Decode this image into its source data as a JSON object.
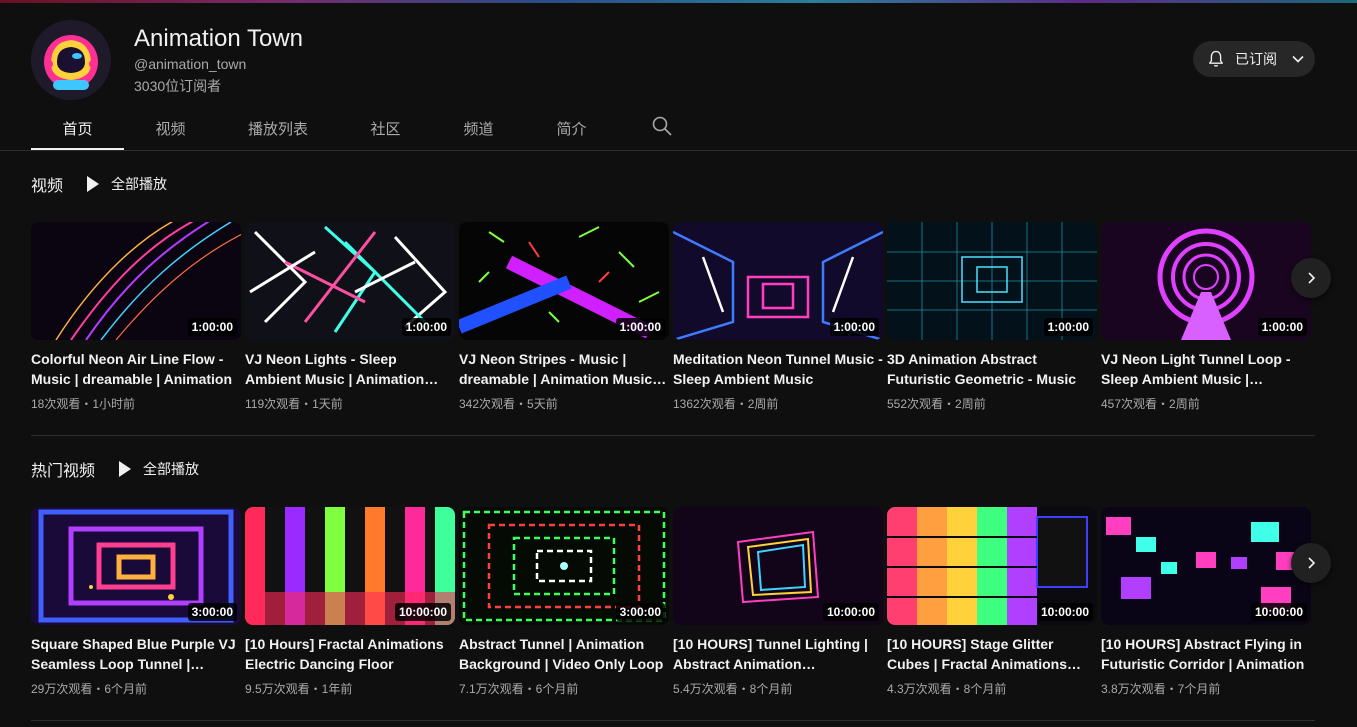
{
  "channel": {
    "name": "Animation Town",
    "handle": "@animation_town",
    "subscribers": "3030位订阅者",
    "subscribe_label": "已订阅"
  },
  "tabs": [
    {
      "label": "首页",
      "active": true
    },
    {
      "label": "视频",
      "active": false
    },
    {
      "label": "播放列表",
      "active": false
    },
    {
      "label": "社区",
      "active": false
    },
    {
      "label": "频道",
      "active": false
    },
    {
      "label": "简介",
      "active": false
    }
  ],
  "icons": {
    "search": "search-icon",
    "bell": "bell-icon",
    "chevron": "chevron-down-icon",
    "next": "chevron-right-icon",
    "play": "play-icon"
  },
  "shelves": [
    {
      "title": "视频",
      "play_all": "全部播放",
      "videos": [
        {
          "title": "Colorful Neon Air Line Flow - Music | dreamable | Animation",
          "duration": "1:00:00",
          "meta": "18次观看・1小时前",
          "theme": "lines"
        },
        {
          "title": "VJ Neon Lights - Sleep Ambient Music | Animation Background",
          "duration": "1:00:00",
          "meta": "119次观看・1天前",
          "theme": "shards"
        },
        {
          "title": "VJ Neon Stripes - Music | dreamable | Animation Music Video",
          "duration": "1:00:00",
          "meta": "342次观看・5天前",
          "theme": "stripes"
        },
        {
          "title": "Meditation Neon Tunnel Music - Sleep Ambient Music",
          "duration": "1:00:00",
          "meta": "1362次观看・2周前",
          "theme": "tunnel"
        },
        {
          "title": "3D Animation Abstract Futuristic Geometric - Music",
          "duration": "1:00:00",
          "meta": "552次观看・2周前",
          "theme": "grid"
        },
        {
          "title": "VJ Neon Light Tunnel Loop - Sleep Ambient Music | Animation",
          "duration": "1:00:00",
          "meta": "457次观看・2周前",
          "theme": "rings"
        }
      ]
    },
    {
      "title": "热门视频",
      "play_all": "全部播放",
      "videos": [
        {
          "title": "Square Shaped Blue Purple VJ Seamless Loop Tunnel | Animation",
          "duration": "3:00:00",
          "meta": "29万次观看・6个月前",
          "theme": "squares"
        },
        {
          "title": "[10 Hours] Fractal Animations Electric Dancing Floor",
          "duration": "10:00:00",
          "meta": "9.5万次观看・1年前",
          "theme": "bars"
        },
        {
          "title": "Abstract Tunnel | Animation Background | Video Only Loop",
          "duration": "3:00:00",
          "meta": "7.1万次观看・6个月前",
          "theme": "greentunnel"
        },
        {
          "title": "[10 HOURS] Tunnel Lighting | Abstract Animation Background",
          "duration": "10:00:00",
          "meta": "5.4万次观看・8个月前",
          "theme": "frames"
        },
        {
          "title": "[10 HOURS] Stage Glitter Cubes | Fractal Animations Background",
          "duration": "10:00:00",
          "meta": "4.3万次观看・8个月前",
          "theme": "cubes"
        },
        {
          "title": "[10 HOURS] Abstract Flying in Futuristic Corridor | Animation",
          "duration": "10:00:00",
          "meta": "3.8万次观看・7个月前",
          "theme": "corridor"
        }
      ]
    }
  ]
}
